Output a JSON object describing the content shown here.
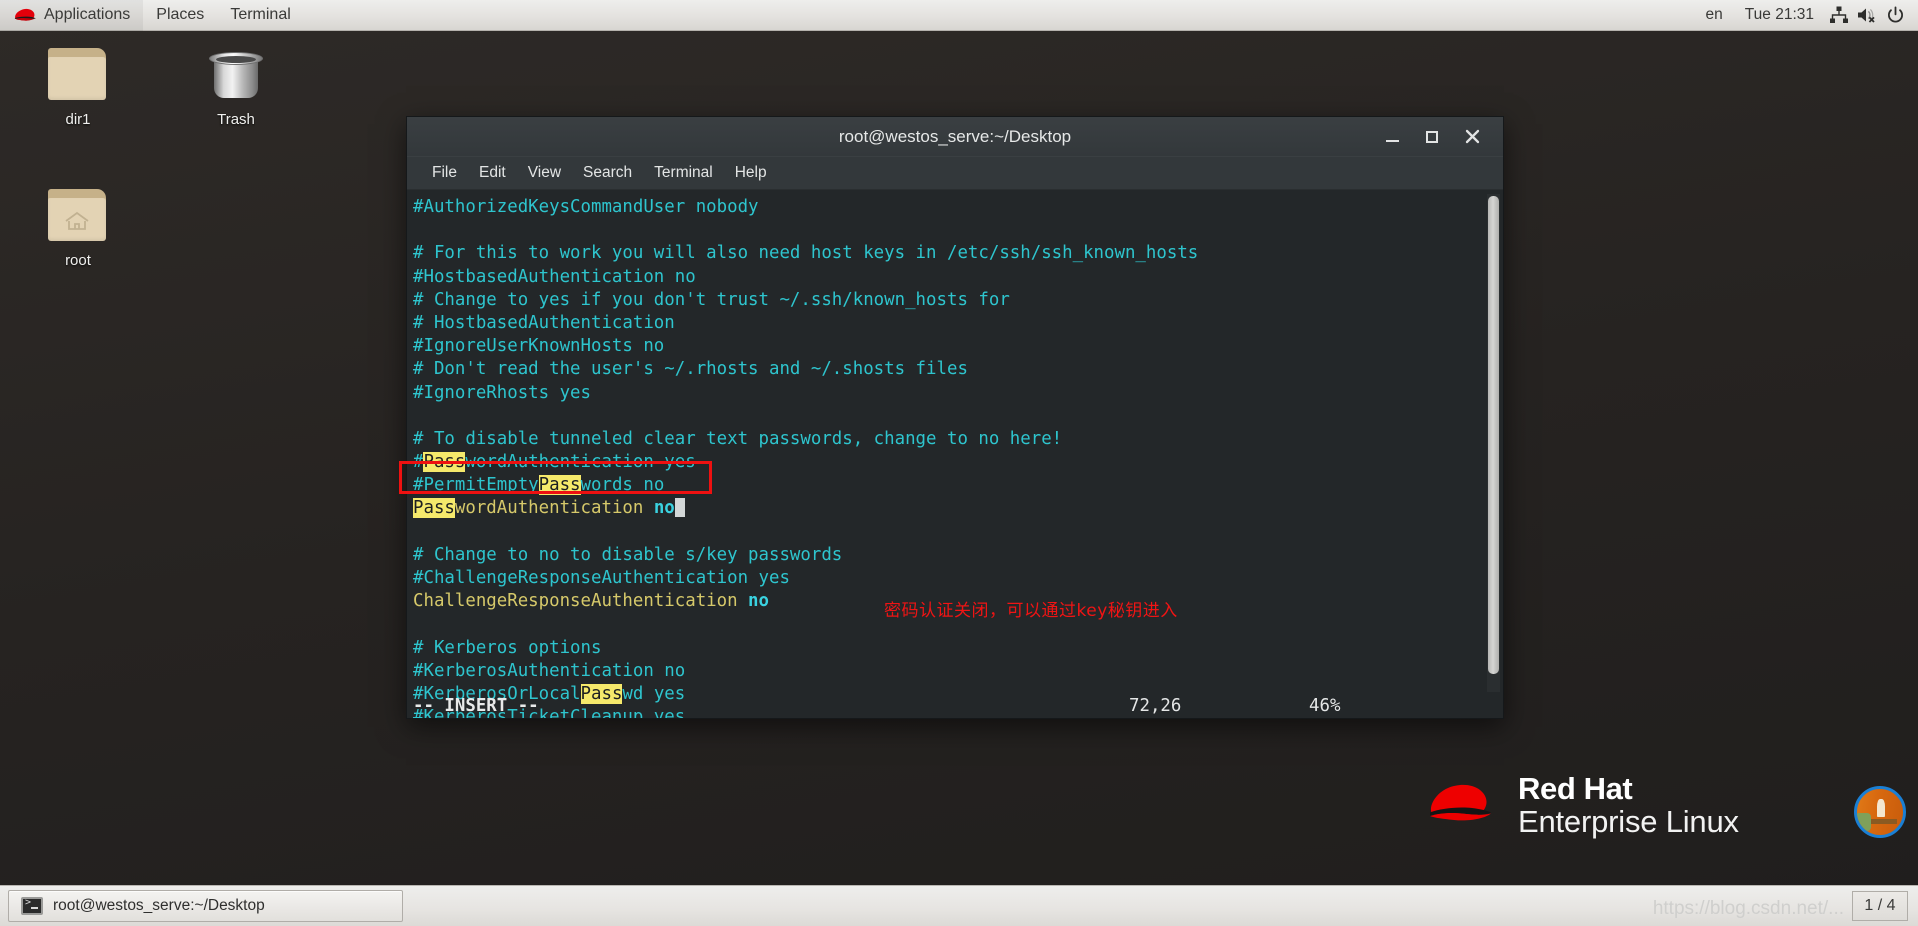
{
  "top_panel": {
    "logo_icon": "redhat-fedora-icon",
    "menus": [
      "Applications",
      "Places",
      "Terminal"
    ],
    "keyboard_layout": "en",
    "clock": "Tue 21:31",
    "tray_icons": [
      "network-icon",
      "volume-muted-icon",
      "power-icon"
    ]
  },
  "desktop": {
    "icons": [
      {
        "label": "dir1",
        "icon": "folder-icon"
      },
      {
        "label": "Trash",
        "icon": "trash-icon"
      },
      {
        "label": "root",
        "icon": "home-folder-icon"
      }
    ],
    "branding": {
      "line1": "Red Hat",
      "line2": "Enterprise Linux",
      "logo_icon": "redhat-hat-icon"
    },
    "wallpaper_thumb_icon": "wallpaper-preview-icon"
  },
  "terminal": {
    "title": "root@westos_serve:~/Desktop",
    "window_buttons": {
      "minimize": "minimize-icon",
      "maximize": "maximize-icon",
      "close": "close-icon"
    },
    "menu": [
      "File",
      "Edit",
      "View",
      "Search",
      "Terminal",
      "Help"
    ],
    "colors": {
      "background": "#232729",
      "comment": "#2ec5ce",
      "active_setting": "#d6c96a",
      "search_highlight": "#f5e96b",
      "annotation_red": "#ee1111"
    },
    "lines": [
      {
        "segments": [
          {
            "t": "#AuthorizedKeysCommandUser nobody",
            "c": "cyan"
          }
        ]
      },
      {
        "segments": []
      },
      {
        "segments": [
          {
            "t": "# For this to work you will also need host keys in /etc/ssh/ssh_known_hosts",
            "c": "cyan"
          }
        ]
      },
      {
        "segments": [
          {
            "t": "#HostbasedAuthentication no",
            "c": "cyan"
          }
        ]
      },
      {
        "segments": [
          {
            "t": "# Change to yes if you don't trust ~/.ssh/known_hosts for",
            "c": "cyan"
          }
        ]
      },
      {
        "segments": [
          {
            "t": "# HostbasedAuthentication",
            "c": "cyan"
          }
        ]
      },
      {
        "segments": [
          {
            "t": "#IgnoreUserKnownHosts no",
            "c": "cyan"
          }
        ]
      },
      {
        "segments": [
          {
            "t": "# Don't read the user's ~/.rhosts and ~/.shosts files",
            "c": "cyan"
          }
        ]
      },
      {
        "segments": [
          {
            "t": "#IgnoreRhosts yes",
            "c": "cyan"
          }
        ]
      },
      {
        "segments": []
      },
      {
        "segments": [
          {
            "t": "# To disable tunneled clear text passwords, change to no here!",
            "c": "cyan"
          }
        ]
      },
      {
        "segments": [
          {
            "t": "#",
            "c": "cyan"
          },
          {
            "t": "Pass",
            "c": "hl"
          },
          {
            "t": "wordAuthentication yes",
            "c": "cyan"
          }
        ]
      },
      {
        "segments": [
          {
            "t": "#PermitEmpty",
            "c": "cyan"
          },
          {
            "t": "Pass",
            "c": "hl"
          },
          {
            "t": "words no",
            "c": "cyan"
          }
        ]
      },
      {
        "segments": [
          {
            "t": "Pass",
            "c": "hl"
          },
          {
            "t": "wordAuthentication ",
            "c": "amber"
          },
          {
            "t": "no",
            "c": "boldcyan"
          },
          {
            "t": "█",
            "c": "cursor"
          }
        ]
      },
      {
        "segments": []
      },
      {
        "segments": [
          {
            "t": "# Change to no to disable s/key passwords",
            "c": "cyan"
          }
        ]
      },
      {
        "segments": [
          {
            "t": "#ChallengeResponseAuthentication yes",
            "c": "cyan"
          }
        ]
      },
      {
        "segments": [
          {
            "t": "ChallengeResponseAuthentication ",
            "c": "amber"
          },
          {
            "t": "no",
            "c": "boldcyan"
          }
        ]
      },
      {
        "segments": []
      },
      {
        "segments": [
          {
            "t": "# Kerberos options",
            "c": "cyan"
          }
        ]
      },
      {
        "segments": [
          {
            "t": "#KerberosAuthentication no",
            "c": "cyan"
          }
        ]
      },
      {
        "segments": [
          {
            "t": "#KerberosOrLocal",
            "c": "cyan"
          },
          {
            "t": "Pass",
            "c": "hl"
          },
          {
            "t": "wd yes",
            "c": "cyan"
          }
        ]
      },
      {
        "segments": [
          {
            "t": "#KerberosTicketCleanup yes",
            "c": "cyan"
          }
        ]
      }
    ],
    "status": {
      "mode": "-- INSERT --",
      "position": "72,26",
      "percent": "46%"
    },
    "annotation": "密码认证关闭，可以通过key秘钥进入"
  },
  "taskbar": {
    "window_button": {
      "label": "root@westos_serve:~/Desktop",
      "icon": "terminal-icon"
    },
    "workspace_switcher": "1 / 4",
    "watermark": "https://blog.csdn.net/..."
  }
}
